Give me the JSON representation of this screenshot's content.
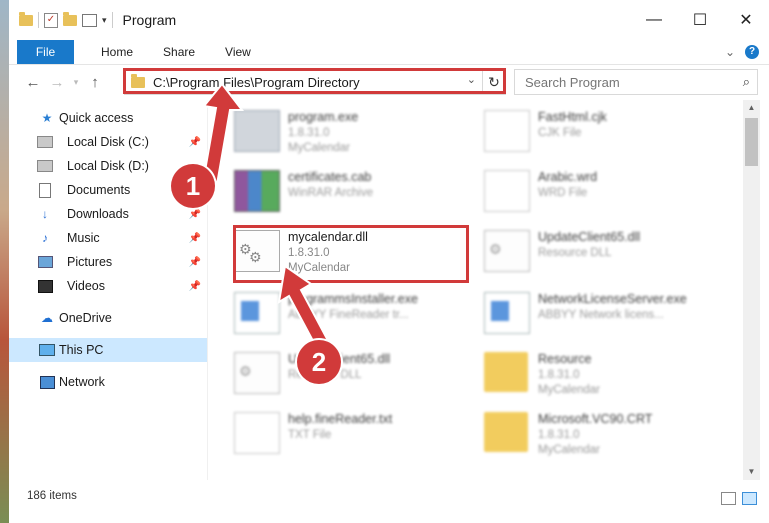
{
  "window": {
    "title": "Program",
    "controls": {
      "minimize": "—",
      "maximize": "☐",
      "close": "✕"
    }
  },
  "ribbon": {
    "tabs": [
      "File",
      "Home",
      "Share",
      "View"
    ]
  },
  "address": {
    "path": "C:\\Program Files\\Program Directory"
  },
  "search": {
    "placeholder": "Search Program"
  },
  "sidebar": {
    "items": [
      {
        "label": "Quick access",
        "icon": "star-icon",
        "pinned": false
      },
      {
        "label": "Local Disk (C:)",
        "icon": "drive-icon",
        "pinned": true
      },
      {
        "label": "Local Disk (D:)",
        "icon": "drive-icon",
        "pinned": false
      },
      {
        "label": "Documents",
        "icon": "documents-icon",
        "pinned": true
      },
      {
        "label": "Downloads",
        "icon": "downloads-icon",
        "pinned": true
      },
      {
        "label": "Music",
        "icon": "music-icon",
        "pinned": true
      },
      {
        "label": "Pictures",
        "icon": "pictures-icon",
        "pinned": true
      },
      {
        "label": "Videos",
        "icon": "videos-icon",
        "pinned": true
      },
      {
        "label": "OneDrive",
        "icon": "onedrive-icon",
        "pinned": false
      },
      {
        "label": "This PC",
        "icon": "pc-icon",
        "pinned": false,
        "selected": true
      },
      {
        "label": "Network",
        "icon": "network-icon",
        "pinned": false
      }
    ]
  },
  "files": [
    {
      "name": "program.exe",
      "line2": "1.8.31.0",
      "line3": "MyCalendar"
    },
    {
      "name": "FastHtml.cjk",
      "line2": "CJK File",
      "line3": ""
    },
    {
      "name": "certificates.cab",
      "line2": "WinRAR Archive",
      "line3": ""
    },
    {
      "name": "Arabic.wrd",
      "line2": "WRD File",
      "line3": ""
    },
    {
      "name": "mycalendar.dll",
      "line2": "1.8.31.0",
      "line3": "MyCalendar"
    },
    {
      "name": "UpdateClient65.dll",
      "line2": "Resource DLL",
      "line3": ""
    },
    {
      "name": "programmsInstaller.exe",
      "line2": "ABBYY FineReader tr...",
      "line3": ""
    },
    {
      "name": "NetworkLicenseServer.exe",
      "line2": "ABBYY Network licens...",
      "line3": ""
    },
    {
      "name": "UpdateClient65.dll",
      "line2": "Resource DLL",
      "line3": ""
    },
    {
      "name": "Resource",
      "line2": "1.8.31.0",
      "line3": "MyCalendar"
    },
    {
      "name": "help.fineReader.txt",
      "line2": "TXT File",
      "line3": ""
    },
    {
      "name": "Microsoft.VC90.CRT",
      "line2": "1.8.31.0",
      "line3": "MyCalendar"
    }
  ],
  "status": {
    "count": "186 items"
  },
  "annotations": {
    "step1": "1",
    "step2": "2",
    "color": "#d13a3a"
  }
}
